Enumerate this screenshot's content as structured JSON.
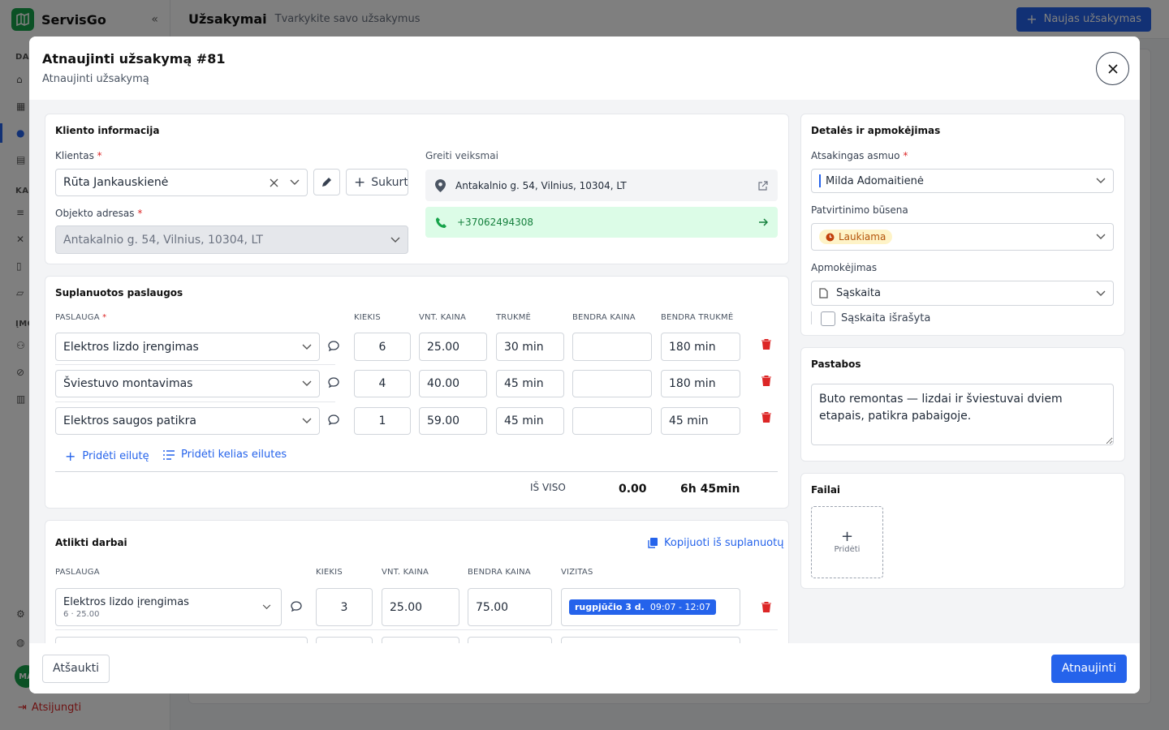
{
  "app": {
    "brand": "ServisGo",
    "page_title": "Užsakymai",
    "page_subtitle": "Tvarkykite savo užsakymus",
    "new_order_button": "Naujas užsakymas",
    "sidebar_sections": [
      "DA",
      "KA",
      "ĮMO"
    ],
    "avatar_initials": "MA",
    "logout_label": "Atsijungti",
    "brand_color": "#16a34a",
    "accent_color": "#2563eb"
  },
  "modal": {
    "title": "Atnaujinti užsakymą #81",
    "subtitle": "Atnaujinti užsakymą",
    "cancel_label": "Atšaukti",
    "submit_label": "Atnaujinti"
  },
  "client": {
    "section_title": "Kliento informacija",
    "client_label": "Klientas",
    "client_value": "Rūta Jankauskienė",
    "create_label": "Sukurti",
    "address_label": "Objekto adresas",
    "address_value": "Antakalnio g. 54, Vilnius, 10304, LT",
    "quick_actions_label": "Greiti veiksmai",
    "quick_address": "Antakalnio g. 54, Vilnius, 10304, LT",
    "quick_phone": "+37062494308"
  },
  "planned": {
    "section_title": "Suplanuotos paslaugos",
    "headers": {
      "service": "PASLAUGA",
      "qty": "KIEKIS",
      "unit_price": "VNT. KAINA",
      "duration": "TRUKMĖ",
      "total_price": "BENDRA KAINA",
      "total_duration": "BENDRA TRUKMĖ"
    },
    "rows": [
      {
        "service": "Elektros lizdo įrengimas",
        "qty": "6",
        "unit_price": "25.00",
        "duration": "30 min",
        "total_price": "",
        "total_duration": "180 min"
      },
      {
        "service": "Šviestuvo montavimas",
        "qty": "4",
        "unit_price": "40.00",
        "duration": "45 min",
        "total_price": "",
        "total_duration": "180 min"
      },
      {
        "service": "Elektros saugos patikra",
        "qty": "1",
        "unit_price": "59.00",
        "duration": "45 min",
        "total_price": "",
        "total_duration": "45 min"
      }
    ],
    "add_row_label": "Pridėti eilutę",
    "add_rows_label": "Pridėti kelias eilutes",
    "total_label": "IŠ VISO",
    "total_price": "0.00",
    "total_duration": "6h 45min"
  },
  "done": {
    "section_title": "Atlikti darbai",
    "copy_label": "Kopijuoti iš suplanuotų",
    "headers": {
      "service": "PASLAUGA",
      "qty": "KIEKIS",
      "unit_price": "VNT. KAINA",
      "total_price": "BENDRA KAINA",
      "visit": "VIZITAS"
    },
    "rows": [
      {
        "service": "Elektros lizdo įrengimas",
        "service_meta": "6 · 25.00",
        "qty": "3",
        "unit_price": "25.00",
        "total_price": "75.00",
        "visit_date": "rugpjūčio 3 d.",
        "visit_time": "09:07 - 12:07"
      }
    ]
  },
  "details": {
    "section_title": "Detalės ir apmokėjimas",
    "responsible_label": "Atsakingas asmuo",
    "responsible_value": "Milda Adomaitienė",
    "status_label": "Patvirtinimo būsena",
    "status_value": "Laukiama",
    "payment_label": "Apmokėjimas",
    "payment_value": "Sąskaita",
    "invoice_checkbox_label": "Sąskaita išrašyta"
  },
  "notes": {
    "section_title": "Pastabos",
    "text": "Buto remontas — lizdai ir šviestuvai dviem etapais, patikra pabaigoje."
  },
  "files": {
    "section_title": "Failai",
    "add_label": "Pridėti"
  }
}
